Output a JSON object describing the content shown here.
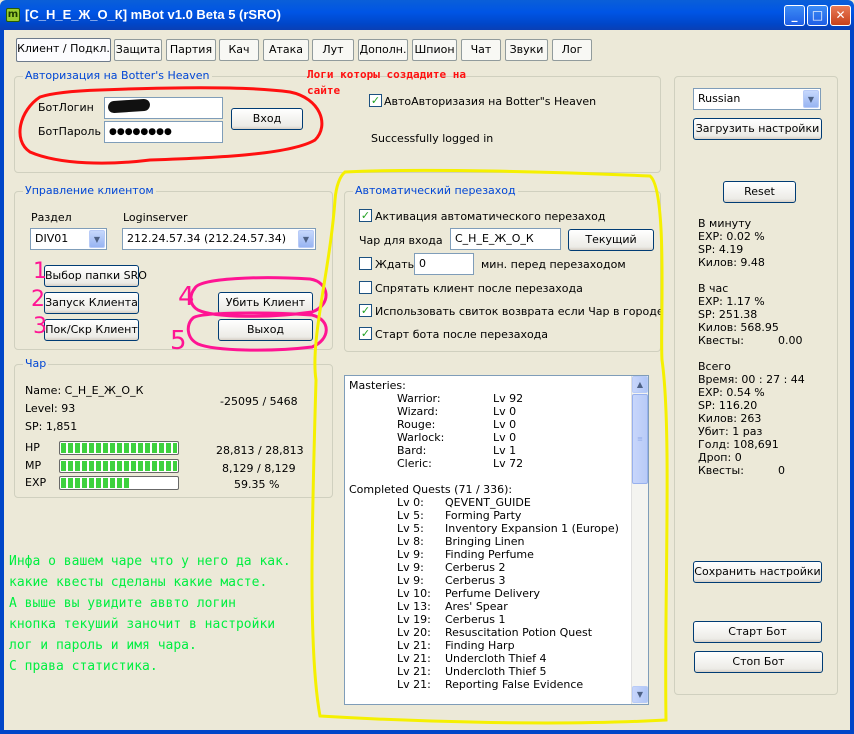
{
  "window": {
    "title": "[С_Н_Е_Ж_О_К] mBot v1.0 Beta 5 (rSRO)",
    "icon": "m",
    "min_glyph": "_",
    "max_glyph": "□",
    "close_glyph": "✕"
  },
  "tabs": [
    "Клиент / Подкл.",
    "Защита",
    "Партия",
    "Кач",
    "Атака",
    "Лут",
    "Дополн.",
    "Шпион",
    "Чат",
    "Звуки",
    "Лог"
  ],
  "auth": {
    "title": "Авторизация на Botter's Heaven",
    "login_label": "БотЛогин",
    "login_value": "",
    "password_label": "БотПароль",
    "password_value": "●●●●●●●●",
    "login_button": "Вход",
    "auto_checkbox_label": "АвтоАвторизазия на Botter\"s Heaven",
    "auto_checked": true,
    "status": "Successfully logged in"
  },
  "client": {
    "title": "Управление клиентом",
    "division_label": "Раздел",
    "division_value": "DIV01",
    "loginserver_label": "Loginserver",
    "loginserver_value": "212.24.57.34 (212.24.57.34)",
    "btn_select_folder": "Выбор папки SRO",
    "btn_start_client": "Запуск Клиента",
    "btn_show_hide": "Пок/Скр Клиент",
    "btn_kill_client": "Убить Клиент",
    "btn_exit": "Выход"
  },
  "relog": {
    "title": "Автоматический перезаход",
    "activate_label": "Активация автоматического перезаход",
    "activate_checked": true,
    "char_label": "Чар для входа",
    "char_value": "С_Н_Е_Ж_О_К",
    "current_button": "Текущий",
    "wait_label": "Ждать",
    "wait_checked": false,
    "wait_value": "0",
    "wait_suffix": "мин. перед перезаходом",
    "hide_label": "Спрятать клиент после перезахода",
    "hide_checked": false,
    "scroll_label": "Использовать свиток возврата если Чар в городе",
    "scroll_checked": true,
    "start_label": "Старт бота после перезахода",
    "start_checked": true
  },
  "char": {
    "title": "Чар",
    "name_line": "Name: С_Н_Е_Ж_О_К",
    "level_line": "Level: 93",
    "sp_line": "SP: 1,851",
    "coords": "-25095 / 5468",
    "hp_label": "HP",
    "hp_value": "28,813 / 28,813",
    "hp_fraction": 1.0,
    "mp_label": "MP",
    "mp_value": "8,129 / 8,129",
    "mp_fraction": 1.0,
    "exp_label": "EXP",
    "exp_value": "59.35 %",
    "exp_fraction": 0.5935
  },
  "masteries": {
    "header": "Masteries:",
    "items": [
      {
        "name": "Warrior:",
        "level": "Lv 92"
      },
      {
        "name": "Wizard:",
        "level": "Lv 0"
      },
      {
        "name": "Rouge:",
        "level": "Lv 0"
      },
      {
        "name": "Warlock:",
        "level": "Lv 0"
      },
      {
        "name": "Bard:",
        "level": "Lv 1"
      },
      {
        "name": "Cleric:",
        "level": "Lv 72"
      }
    ]
  },
  "quests": {
    "header": "Completed Quests (71 / 336):",
    "items": [
      {
        "lv": "Lv 0:",
        "name": "QEVENT_GUIDE"
      },
      {
        "lv": "Lv 5:",
        "name": "Forming Party"
      },
      {
        "lv": "Lv 5:",
        "name": "Inventory Expansion 1 (Europe)"
      },
      {
        "lv": "Lv 8:",
        "name": "Bringing Linen"
      },
      {
        "lv": "Lv 9:",
        "name": "Finding Perfume"
      },
      {
        "lv": "Lv 9:",
        "name": "Cerberus 2"
      },
      {
        "lv": "Lv 9:",
        "name": "Cerberus 3"
      },
      {
        "lv": "Lv 10:",
        "name": "Perfume Delivery"
      },
      {
        "lv": "Lv 13:",
        "name": "Ares' Spear"
      },
      {
        "lv": "Lv 19:",
        "name": "Cerberus 1"
      },
      {
        "lv": "Lv 20:",
        "name": "Resuscitation Potion Quest"
      },
      {
        "lv": "Lv 21:",
        "name": "Finding Harp"
      },
      {
        "lv": "Lv 21:",
        "name": "Undercloth Thief 4"
      },
      {
        "lv": "Lv 21:",
        "name": "Undercloth Thief 5"
      },
      {
        "lv": "Lv 21:",
        "name": "Reporting False Evidence"
      }
    ]
  },
  "stats": {
    "language": "Russian",
    "load_button": "Загрузить настройки",
    "reset_button": "Reset",
    "per_minute": {
      "header": "В минуту",
      "lines": [
        "EXP:   0.02 %",
        "SP:     4.19",
        "Килов: 9.48"
      ]
    },
    "per_hour": {
      "header": "В час",
      "lines": [
        "EXP:   1.17 %",
        "SP:     251.38",
        "Килов: 568.95"
      ],
      "quests_label": "Квесты:",
      "quests_value": "0.00"
    },
    "total": {
      "header": "Всего",
      "lines": [
        "Время:  00 : 27 : 44",
        "EXP:   0.54 %",
        "SP:     116.20",
        "Килов: 263",
        "Убит:  1 раз",
        "Голд:  108,691",
        "Дроп:  0"
      ],
      "quests_label": "Квесты:",
      "quests_value": "0"
    },
    "save_button": "Сохранить настройки",
    "start_button": "Старт Бот",
    "stop_button": "Стоп Бот"
  },
  "annotations": {
    "red_note_line1": "Логи которы создадите на",
    "red_note_line2": "сайте",
    "markers": [
      "1",
      "2",
      "3",
      "4",
      "5"
    ],
    "green_lines": [
      "Инфа о вашем чаре что у него да как.",
      "какие квесты сделаны какие масте.",
      "А выше вы увидите аввто логин",
      "кнопка текуший заночит в настройки",
      "лог и пароль и имя чара.",
      "С права статистика."
    ],
    "colors": {
      "red": "#ff1010",
      "pink": "#ff1493",
      "yellow": "#f5f000",
      "green": "#00ee40"
    }
  }
}
